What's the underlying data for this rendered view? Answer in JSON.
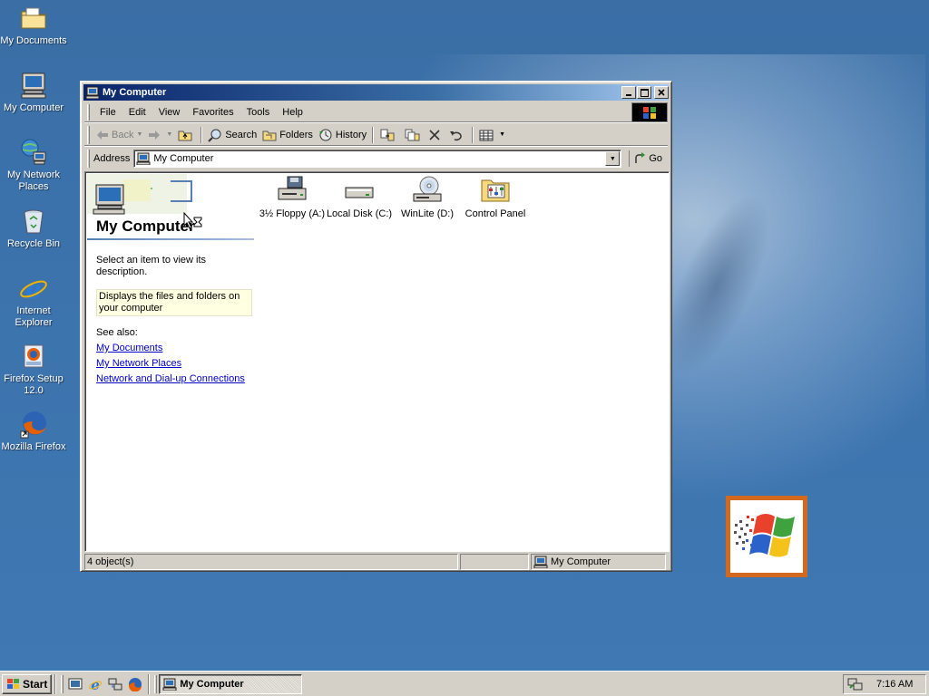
{
  "desktop": {
    "icons": [
      {
        "label": "My Documents",
        "icon": "folder-documents-icon"
      },
      {
        "label": "My Computer",
        "icon": "computer-icon"
      },
      {
        "label": "My Network Places",
        "icon": "network-icon"
      },
      {
        "label": "Recycle Bin",
        "icon": "recycle-bin-icon"
      },
      {
        "label": "Internet Explorer",
        "icon": "internet-explorer-icon"
      },
      {
        "label": "Firefox Setup 12.0",
        "icon": "firefox-setup-icon"
      },
      {
        "label": "Mozilla Firefox",
        "icon": "firefox-icon"
      }
    ]
  },
  "window": {
    "title": "My Computer",
    "menu": [
      "File",
      "Edit",
      "View",
      "Favorites",
      "Tools",
      "Help"
    ],
    "toolbar": {
      "back": "Back",
      "search": "Search",
      "folders": "Folders",
      "history": "History"
    },
    "address": {
      "label": "Address",
      "value": "My Computer",
      "go": "Go"
    },
    "webview": {
      "title": "My Computer",
      "description": "Select an item to view its description.",
      "info": "Displays the files and folders on your computer",
      "see_also": "See also:",
      "links": [
        "My Documents",
        "My Network Places",
        "Network and Dial-up Connections"
      ]
    },
    "drives": [
      {
        "label": "3½ Floppy (A:)",
        "icon": "floppy-drive-icon"
      },
      {
        "label": "Local Disk (C:)",
        "icon": "hard-disk-icon"
      },
      {
        "label": "WinLite (D:)",
        "icon": "cd-drive-icon"
      },
      {
        "label": "Control Panel",
        "icon": "control-panel-icon"
      }
    ],
    "status": {
      "objects": "4 object(s)",
      "zone": "My Computer"
    }
  },
  "taskbar": {
    "start": "Start",
    "task": "My Computer",
    "time": "7:16 AM"
  },
  "colors": {
    "desktop": "#3a6ea5",
    "titlebar_start": "#0a246a",
    "titlebar_end": "#a6caf0",
    "face": "#d4d0c8",
    "link": "#0000cc",
    "info_bg": "#ffffe1",
    "logo_border": "#d2691e"
  }
}
